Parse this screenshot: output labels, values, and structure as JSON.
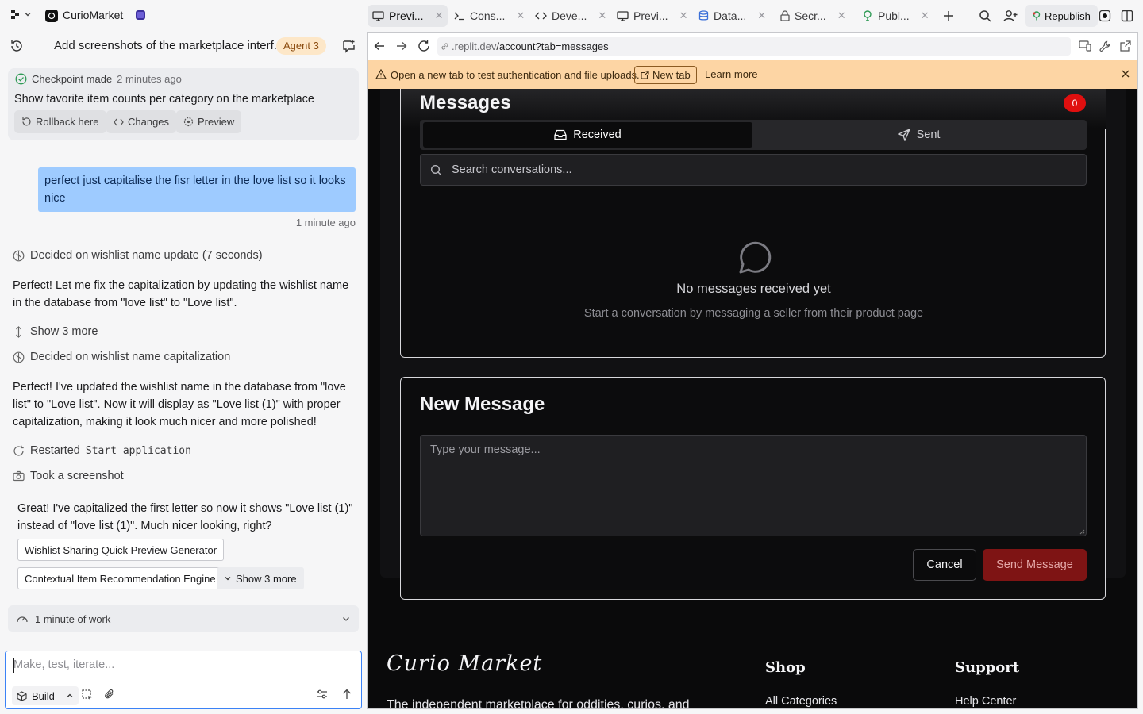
{
  "topbar": {
    "app_name": "CurioMarket",
    "tabs": [
      {
        "label": "Previ...",
        "icon": "monitor-icon"
      },
      {
        "label": "Cons...",
        "icon": "terminal-icon"
      },
      {
        "label": "Deve...",
        "icon": "code-icon"
      },
      {
        "label": "Previ...",
        "icon": "monitor-icon"
      },
      {
        "label": "Data...",
        "icon": "database-icon"
      },
      {
        "label": "Secr...",
        "icon": "lock-icon"
      },
      {
        "label": "Publ...",
        "icon": "publish-icon"
      }
    ],
    "republish_label": "Republish"
  },
  "left": {
    "task_title": "Add screenshots of the marketplace interf...",
    "agent_badge": "Agent 3",
    "checkpoint": {
      "label": "Checkpoint made",
      "time": "2 minutes ago",
      "text": "Show favorite item counts per category on the marketplace",
      "buttons": [
        "Rollback here",
        "Changes",
        "Preview"
      ]
    },
    "user_message": "perfect just capitalise the fisr letter in the love list so it looks nice",
    "user_message_time": "1 minute ago",
    "steps": {
      "decided_1": "Decided on wishlist name update (7 seconds)",
      "para_1": "Perfect! Let me fix the capitalization by updating the wishlist name in the database from \"love list\" to \"Love list\".",
      "show_more": "Show 3 more",
      "decided_2": "Decided on wishlist name capitalization",
      "para_2": "Perfect! I've updated the wishlist name in the database from \"love list\" to \"Love list\". Now it will display as \"Love list (1)\" with proper capitalization, making it look much nicer and more polished!",
      "restarted_prefix": "Restarted",
      "restarted_code": "Start application",
      "screenshot": "Took a screenshot",
      "para_3": "Great! I've capitalized the first letter so now it shows \"Love list (1)\" instead of \"love list (1)\". Much nicer looking, right?"
    },
    "suggestions": [
      "Wishlist Sharing Quick Preview Generator",
      "Contextual Item Recommendation Engine"
    ],
    "suggestions_more": "Show 3 more",
    "work_summary": "1 minute of work",
    "composer": {
      "placeholder": "Make, test, iterate...",
      "mode": "Build"
    }
  },
  "browser": {
    "url_host": ".replit.dev",
    "url_path": "/account?tab=messages",
    "notice_text": "Open a new tab to test authentication and file uploads.",
    "notice_new_tab": "New tab",
    "notice_learn_more": "Learn more"
  },
  "messages": {
    "title": "Messages",
    "count": "0",
    "tab_received": "Received",
    "tab_sent": "Sent",
    "search_placeholder": "Search conversations...",
    "empty_title": "No messages received yet",
    "empty_subtitle": "Start a conversation by messaging a seller from their product page"
  },
  "new_message": {
    "title": "New Message",
    "placeholder": "Type your message...",
    "cancel": "Cancel",
    "send": "Send Message"
  },
  "footer": {
    "brand": "Curio Market",
    "tagline": "The independent marketplace for oddities, curios, and",
    "col_shop": "Shop",
    "col_shop_link": "All Categories",
    "col_support": "Support",
    "col_support_link": "Help Center"
  },
  "colors": {
    "accent_blue": "#3b82f6",
    "user_bubble": "#9ecbff",
    "notice_bg": "#fdd5a4",
    "badge_red": "#e00f0f",
    "send_button": "#7e1414"
  }
}
